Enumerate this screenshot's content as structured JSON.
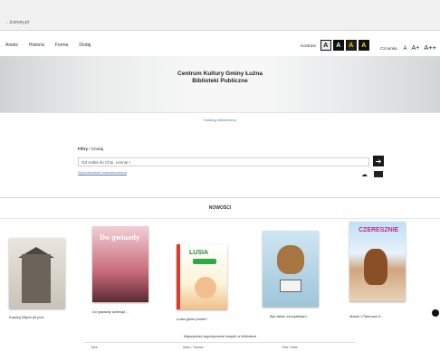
{
  "browser": {
    "url": "…lcorvey.pl"
  },
  "nav": {
    "items": [
      "Aneks",
      "Historia",
      "Forma",
      "Dodaj"
    ],
    "contrast_label": "Kontrast",
    "contrast_options": [
      "A",
      "A",
      "A",
      "A"
    ],
    "font_label": "Czcionka",
    "font_sizes": [
      "A",
      "A+",
      "A++"
    ]
  },
  "banner": {
    "title_line1": "Centrum Kultury Gminy Łużna",
    "title_line2": "Biblioteki Publiczne"
  },
  "strip": {
    "link": "Katalog biblioteczny"
  },
  "search": {
    "label_bold": "Filtry",
    "label_rest": " / Szukaj",
    "value": "Od Arabii do Chin. Lennie I",
    "advanced_link": "Wyszukiwanie zaawansowane",
    "go_symbol": "➔"
  },
  "section": {
    "title": "NOWOŚCI"
  },
  "books": [
    {
      "title": "Kaplicę Biłych pił pod…",
      "cover_text": ""
    },
    {
      "title": "Do gwiazdy dziewięt…",
      "cover_text": "Do gwiazdy"
    },
    {
      "title": "Lusia gdzie jesteś?",
      "cover_text": "LUSIA"
    },
    {
      "title": "Być takim szczęśliwym",
      "cover_text": ""
    },
    {
      "title": "Marek i Palmowa D…",
      "cover_text": "CZERESZNIE"
    }
  ],
  "footer": {
    "heading": "Najczęściej wypożyczane książki w bibliotece",
    "columns": [
      "Tytuł",
      "Autor / Twórca",
      "Rok / Data"
    ]
  }
}
